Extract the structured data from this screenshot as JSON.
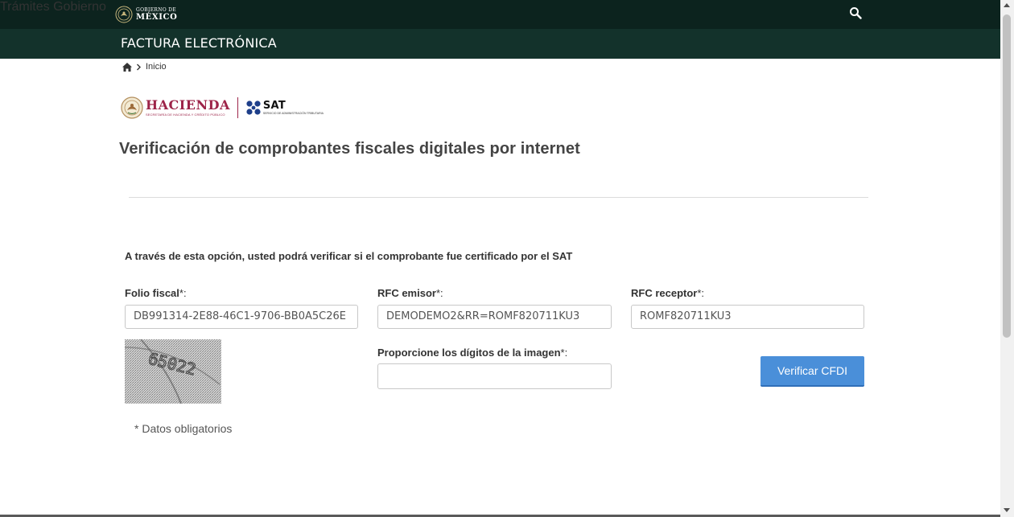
{
  "gov_header": {
    "logo_small": "GOBIERNO DE",
    "logo_big": "MÉXICO",
    "nav": [
      {
        "label": "Trámites"
      },
      {
        "label": "Gobierno"
      }
    ],
    "search_icon": "search-icon",
    "bg_color": "#0c231e"
  },
  "sub_header": {
    "title": "FACTURA ELECTRÓNICA",
    "bg_color": "#13322b"
  },
  "breadcrumb": {
    "home_icon": "home-icon",
    "separator_icon": "chevron-right-icon",
    "current": "Inicio"
  },
  "logos": {
    "hacienda": "HACIENDA",
    "hacienda_sub": "SECRETARÍA DE HACIENDA Y CRÉDITO PÚBLICO",
    "sat": "SAT",
    "sat_sub": "SERVICIO DE ADMINISTRACIÓN TRIBUTARIA",
    "brand_color": "#9d2449"
  },
  "page": {
    "title": "Verificación de comprobantes fiscales digitales por internet",
    "intro": "A través de esta opción, usted podrá verificar si el comprobante fue certificado por el SAT"
  },
  "form": {
    "folio": {
      "label": "Folio fiscal",
      "required_mark": "*:",
      "value": "DB991314-2E88-46C1-9706-BB0A5C26E"
    },
    "rfc_emisor": {
      "label": "RFC emisor",
      "required_mark": "*:",
      "value": "DEMODEMO2&RR=ROMF820711KU3"
    },
    "rfc_receptor": {
      "label": "RFC receptor",
      "required_mark": "*:",
      "value": "ROMF820711KU3"
    },
    "captcha": {
      "label": "Proporcione los dígitos de la imagen",
      "required_mark": "*:",
      "value": "",
      "image_text": "65022"
    },
    "submit": {
      "label": "Verificar CFDI",
      "color": "#4a8fd9"
    },
    "required_note": "* Datos obligatorios"
  }
}
